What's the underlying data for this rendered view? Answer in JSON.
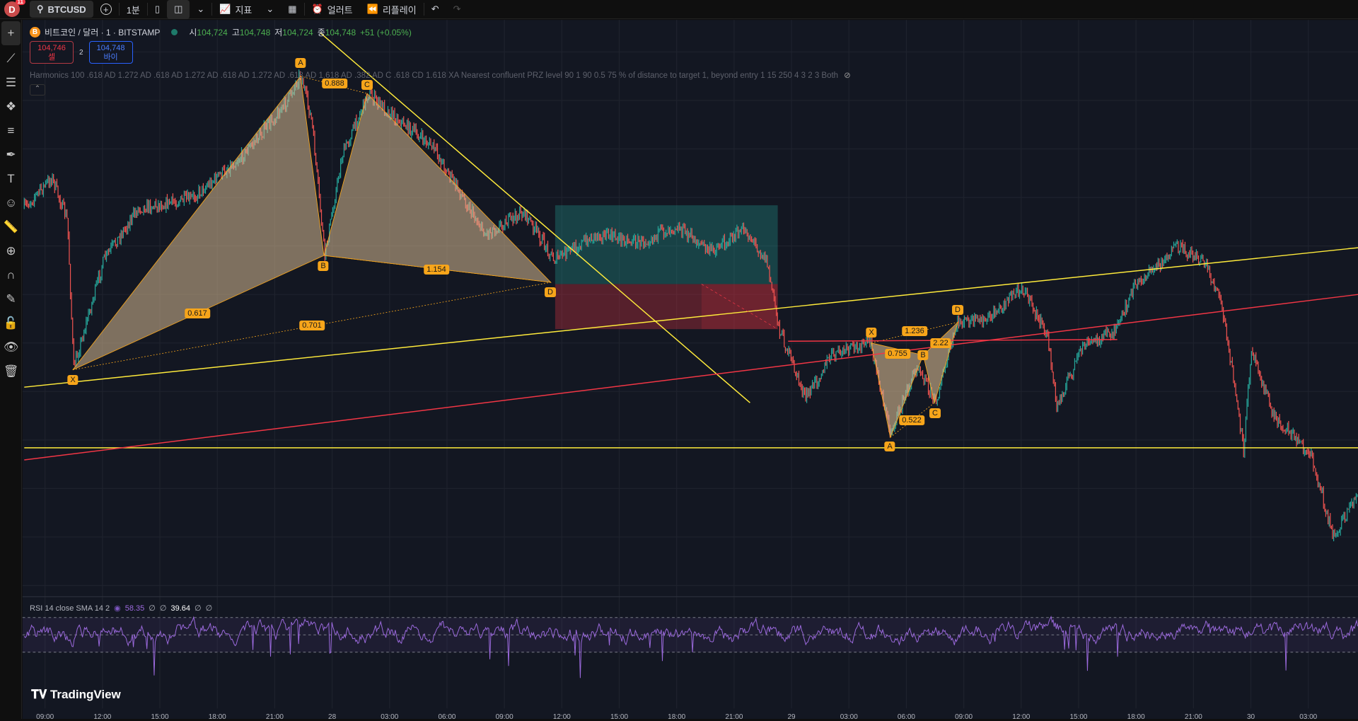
{
  "topbar": {
    "avatar": "D",
    "avatar_badge": "11",
    "symbol": "BTCUSD",
    "interval": "1분",
    "indicators": "지표",
    "alert": "얼러트",
    "replay": "리플레이"
  },
  "legend": {
    "title": "비트코인 / 달러 · 1 · BITSTAMP",
    "o_label": "시",
    "o": "104,724",
    "h_label": "고",
    "h": "104,748",
    "l_label": "저",
    "l": "104,724",
    "c_label": "종",
    "c": "104,748",
    "change": "+51 (+0.05%)"
  },
  "trade": {
    "sell_price": "104,746",
    "sell_label": "셀",
    "spread": "2",
    "buy_price": "104,748",
    "buy_label": "바이"
  },
  "indicator_line": "Harmonics 100 .618 AD 1.272 AD .618 AD 1.272 AD .618 AD 1.272 AD .618 AD 1.618 AD .382 AD C .618 CD 1.618 XA Nearest confluent PRZ level 90 1 90 0.5 75 % of distance to target 1, beyond entry 1 15 250 4 3 2 3 Both",
  "pattern1": {
    "points": [
      "X",
      "A",
      "B",
      "C",
      "D"
    ],
    "ratios": [
      "0.617",
      "0.888",
      "1.154",
      "0.701"
    ]
  },
  "pattern2": {
    "points": [
      "X",
      "A",
      "B",
      "C",
      "D"
    ],
    "ratios": [
      "1.236",
      "0.755",
      "2.22",
      "0.522"
    ]
  },
  "rsi": {
    "label": "RSI 14 close SMA 14 2",
    "value": "58.35",
    "sma": "39.64",
    "na": "∅"
  },
  "logo": "TradingView",
  "time_axis": [
    "09:00",
    "12:00",
    "15:00",
    "18:00",
    "21:00",
    "28",
    "03:00",
    "06:00",
    "09:00",
    "12:00",
    "15:00",
    "18:00",
    "21:00",
    "29",
    "03:00",
    "06:00",
    "09:00",
    "12:00",
    "15:00",
    "18:00",
    "21:00",
    "30",
    "03:00"
  ],
  "colors": {
    "bg": "#131722",
    "up": "#26a69a",
    "down": "#ef5350",
    "pattern": "#f7a51a",
    "yellow": "#ffeb3b",
    "red": "#f23645",
    "rsi": "#9c6ade"
  }
}
